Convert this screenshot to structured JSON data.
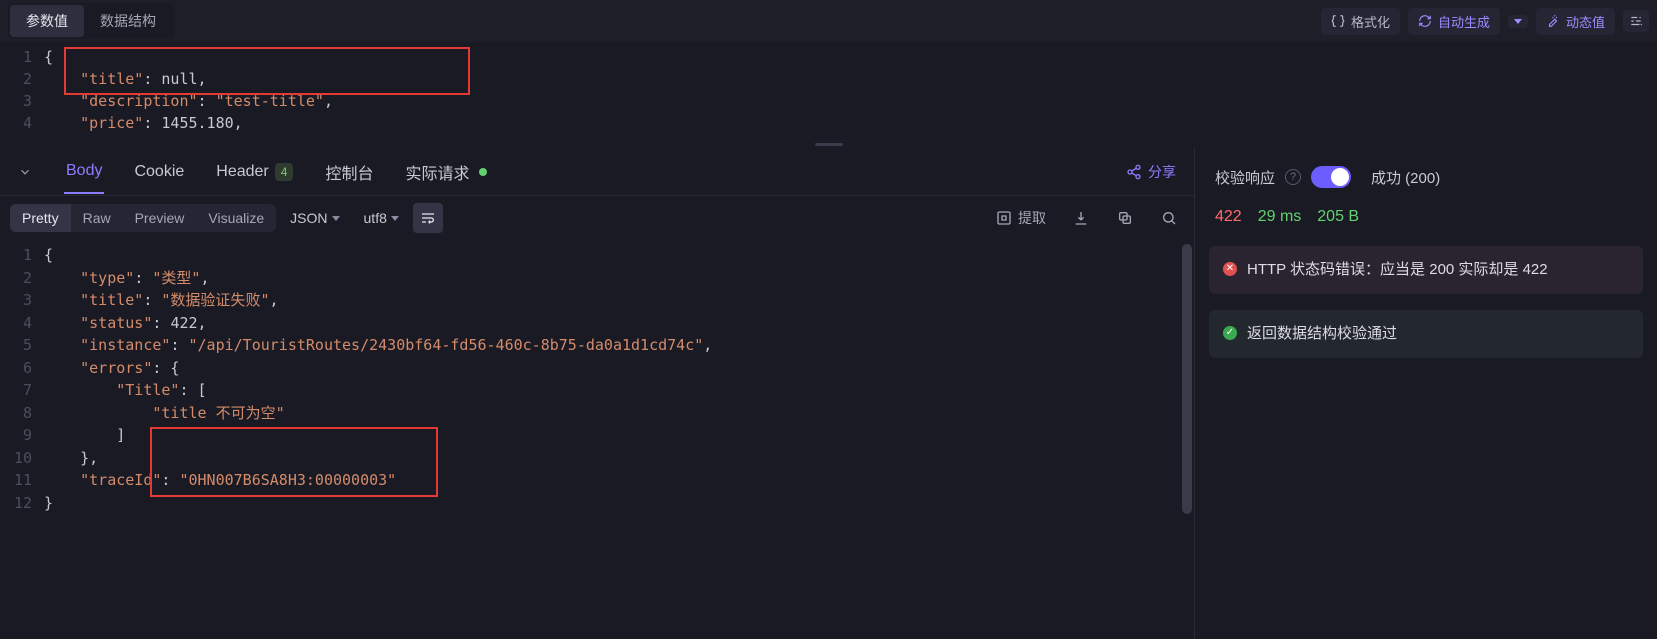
{
  "top": {
    "tabs": [
      "参数值",
      "数据结构"
    ],
    "active": 0,
    "actions": {
      "format": "格式化",
      "auto_gen": "自动生成",
      "dynamic": "动态值"
    }
  },
  "request_body": {
    "lines": [
      {
        "n": 1,
        "html": "<span class=\"tok-punc\">{</span>"
      },
      {
        "n": 2,
        "html": "    <span class=\"tok-key\">\"title\"</span><span class=\"tok-punc\">: </span><span class=\"tok-null\">null</span><span class=\"tok-punc\">,</span>"
      },
      {
        "n": 3,
        "html": "    <span class=\"tok-key\">\"description\"</span><span class=\"tok-punc\">: </span><span class=\"tok-str\">\"test-title\"</span><span class=\"tok-punc\">,</span>"
      },
      {
        "n": 4,
        "html": "    <span class=\"tok-key\">\"price\"</span><span class=\"tok-punc\">: </span><span class=\"tok-num\">1455.180</span><span class=\"tok-punc\">,</span>"
      }
    ]
  },
  "response_tabs": {
    "body": "Body",
    "cookie": "Cookie",
    "header": "Header",
    "header_count": "4",
    "console": "控制台",
    "actual": "实际请求",
    "share": "分享"
  },
  "resp_toolbar": {
    "views": [
      "Pretty",
      "Raw",
      "Preview",
      "Visualize"
    ],
    "active_view": 0,
    "format": "JSON",
    "encoding": "utf8",
    "extract": "提取"
  },
  "response_body": {
    "lines": [
      {
        "n": 1,
        "html": "<span class=\"tok-punc\">{</span>"
      },
      {
        "n": 2,
        "html": "    <span class=\"tok-key\">\"type\"</span><span class=\"tok-punc\">: </span><span class=\"tok-str\">\"类型\"</span><span class=\"tok-punc\">,</span>"
      },
      {
        "n": 3,
        "html": "    <span class=\"tok-key\">\"title\"</span><span class=\"tok-punc\">: </span><span class=\"tok-str\">\"数据验证失败\"</span><span class=\"tok-punc\">,</span>"
      },
      {
        "n": 4,
        "html": "    <span class=\"tok-key\">\"status\"</span><span class=\"tok-punc\">: </span><span class=\"tok-num\">422</span><span class=\"tok-punc\">,</span>"
      },
      {
        "n": 5,
        "html": "    <span class=\"tok-key\">\"instance\"</span><span class=\"tok-punc\">: </span><span class=\"tok-str\">\"/api/TouristRoutes/2430bf64-fd56-460c-8b75-da0a1d1cd74c\"</span><span class=\"tok-punc\">,</span>"
      },
      {
        "n": 6,
        "html": "    <span class=\"tok-key\">\"errors\"</span><span class=\"tok-punc\">: {</span>"
      },
      {
        "n": 7,
        "html": "        <span class=\"tok-key\">\"Title\"</span><span class=\"tok-punc\">: [</span>"
      },
      {
        "n": 8,
        "html": "            <span class=\"tok-str\">\"title 不可为空\"</span>"
      },
      {
        "n": 9,
        "html": "        <span class=\"tok-punc\">]</span>"
      },
      {
        "n": 10,
        "html": "    <span class=\"tok-punc\">},</span>"
      },
      {
        "n": 11,
        "html": "    <span class=\"tok-key\">\"traceId\"</span><span class=\"tok-punc\">: </span><span class=\"tok-str\">\"0HN007B6SA8H3:00000003\"</span>"
      },
      {
        "n": 12,
        "html": "<span class=\"tok-punc\">}</span>"
      }
    ]
  },
  "side": {
    "validate_label": "校验响应",
    "success_label": "成功 (200)",
    "status_code": "422",
    "time": "29 ms",
    "size": "205 B",
    "error_msg": "HTTP 状态码错误：应当是 200 实际却是 422",
    "ok_msg": "返回数据结构校验通过"
  }
}
